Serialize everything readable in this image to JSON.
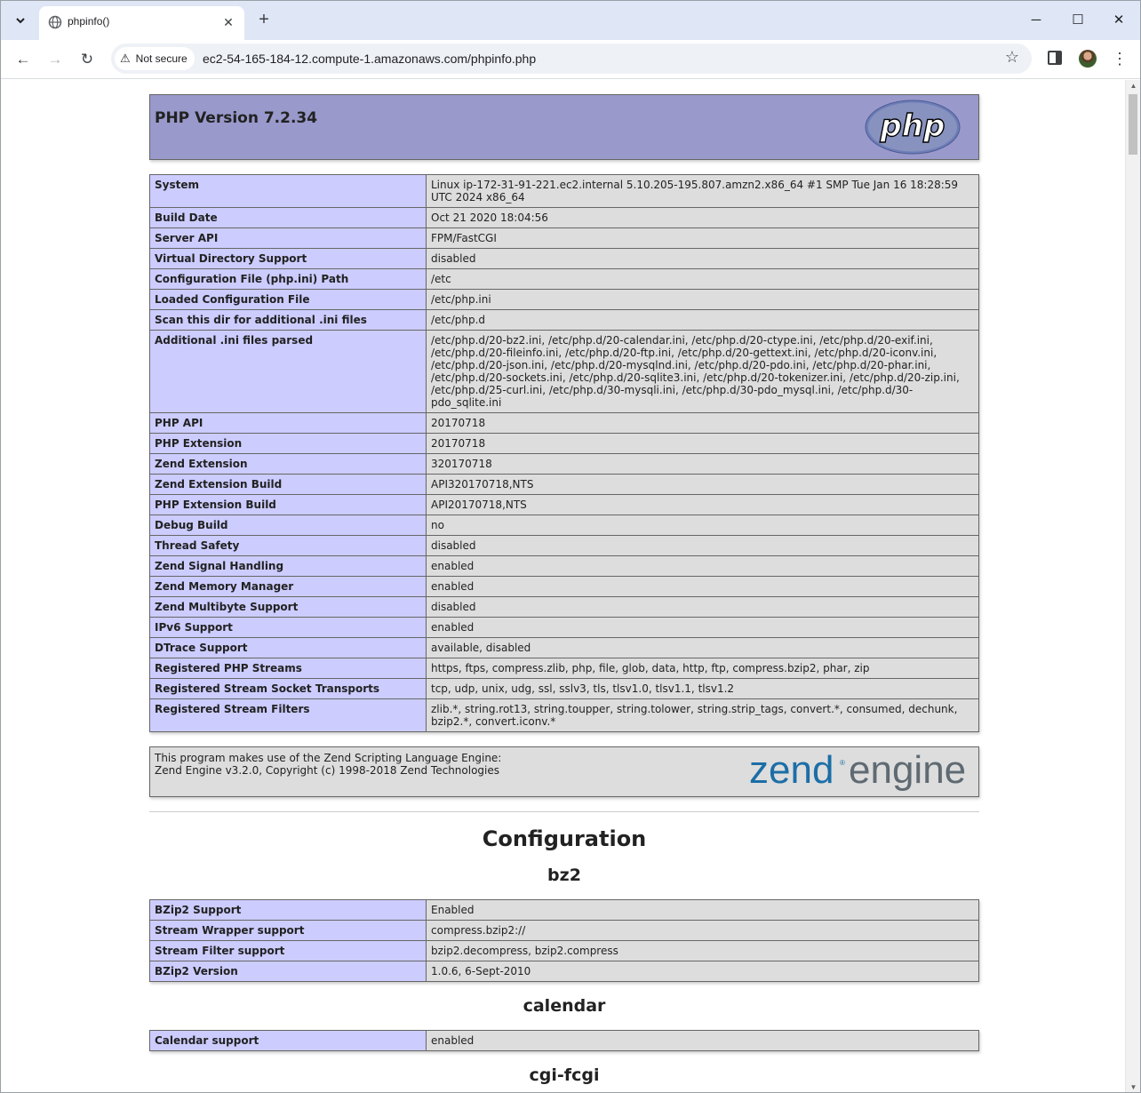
{
  "browser": {
    "tab_title": "phpinfo()",
    "security_label": "Not secure",
    "url": "ec2-54-165-184-12.compute-1.amazonaws.com/phpinfo.php"
  },
  "header": {
    "title": "PHP Version 7.2.34",
    "logo_text": "php"
  },
  "system_rows": [
    {
      "key": "System",
      "value": "Linux ip-172-31-91-221.ec2.internal 5.10.205-195.807.amzn2.x86_64 #1 SMP Tue Jan 16 18:28:59 UTC 2024 x86_64"
    },
    {
      "key": "Build Date",
      "value": "Oct 21 2020 18:04:56"
    },
    {
      "key": "Server API",
      "value": "FPM/FastCGI"
    },
    {
      "key": "Virtual Directory Support",
      "value": "disabled"
    },
    {
      "key": "Configuration File (php.ini) Path",
      "value": "/etc"
    },
    {
      "key": "Loaded Configuration File",
      "value": "/etc/php.ini"
    },
    {
      "key": "Scan this dir for additional .ini files",
      "value": "/etc/php.d"
    },
    {
      "key": "Additional .ini files parsed",
      "value": "/etc/php.d/20-bz2.ini, /etc/php.d/20-calendar.ini, /etc/php.d/20-ctype.ini, /etc/php.d/20-exif.ini, /etc/php.d/20-fileinfo.ini, /etc/php.d/20-ftp.ini, /etc/php.d/20-gettext.ini, /etc/php.d/20-iconv.ini, /etc/php.d/20-json.ini, /etc/php.d/20-mysqlnd.ini, /etc/php.d/20-pdo.ini, /etc/php.d/20-phar.ini, /etc/php.d/20-sockets.ini, /etc/php.d/20-sqlite3.ini, /etc/php.d/20-tokenizer.ini, /etc/php.d/20-zip.ini, /etc/php.d/25-curl.ini, /etc/php.d/30-mysqli.ini, /etc/php.d/30-pdo_mysql.ini, /etc/php.d/30-pdo_sqlite.ini"
    },
    {
      "key": "PHP API",
      "value": "20170718"
    },
    {
      "key": "PHP Extension",
      "value": "20170718"
    },
    {
      "key": "Zend Extension",
      "value": "320170718"
    },
    {
      "key": "Zend Extension Build",
      "value": "API320170718,NTS"
    },
    {
      "key": "PHP Extension Build",
      "value": "API20170718,NTS"
    },
    {
      "key": "Debug Build",
      "value": "no"
    },
    {
      "key": "Thread Safety",
      "value": "disabled"
    },
    {
      "key": "Zend Signal Handling",
      "value": "enabled"
    },
    {
      "key": "Zend Memory Manager",
      "value": "enabled"
    },
    {
      "key": "Zend Multibyte Support",
      "value": "disabled"
    },
    {
      "key": "IPv6 Support",
      "value": "enabled"
    },
    {
      "key": "DTrace Support",
      "value": "available, disabled"
    },
    {
      "key": "Registered PHP Streams",
      "value": "https, ftps, compress.zlib, php, file, glob, data, http, ftp, compress.bzip2, phar, zip"
    },
    {
      "key": "Registered Stream Socket Transports",
      "value": "tcp, udp, unix, udg, ssl, sslv3, tls, tlsv1.0, tlsv1.1, tlsv1.2"
    },
    {
      "key": "Registered Stream Filters",
      "value": "zlib.*, string.rot13, string.toupper, string.tolower, string.strip_tags, convert.*, consumed, dechunk, bzip2.*, convert.iconv.*"
    }
  ],
  "zend": {
    "line1": "This program makes use of the Zend Scripting Language Engine:",
    "line2": "Zend Engine v3.2.0, Copyright (c) 1998-2018 Zend Technologies",
    "logo_word1": "zend",
    "logo_word2": "engine"
  },
  "configuration": {
    "title": "Configuration",
    "modules": [
      {
        "name": "bz2",
        "rows": [
          {
            "key": "BZip2 Support",
            "value": "Enabled"
          },
          {
            "key": "Stream Wrapper support",
            "value": "compress.bzip2://"
          },
          {
            "key": "Stream Filter support",
            "value": "bzip2.decompress, bzip2.compress"
          },
          {
            "key": "BZip2 Version",
            "value": "1.0.6, 6-Sept-2010"
          }
        ]
      },
      {
        "name": "calendar",
        "rows": [
          {
            "key": "Calendar support",
            "value": "enabled"
          }
        ]
      },
      {
        "name": "cgi-fcgi",
        "rows": []
      }
    ]
  }
}
